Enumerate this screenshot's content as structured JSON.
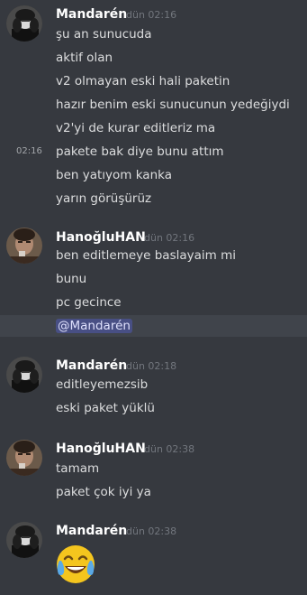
{
  "colors": {
    "background": "#36393f",
    "username": "#ffffff",
    "message_text": "#dcddde",
    "timestamp": "#72767d",
    "mention_highlight": "#40444b",
    "mention_pill": "#5865f2"
  },
  "groups": [
    {
      "avatar_icon": "avatar-mandaren-icon",
      "username": "Mandarén",
      "timestamp": "dün 02:16",
      "hover_timestamp": "02:16",
      "messages": [
        "şu an sunucuda",
        "aktif olan",
        "v2 olmayan eski hali paketin",
        "hazır benim eski sunucunun yedeğiydi",
        "v2'yi de kurar editleriz ma",
        "pakete bak diye bunu attım",
        "ben yatıyom kanka",
        "yarın görüşürüz"
      ]
    },
    {
      "avatar_icon": "avatar-hanogluhan-icon",
      "username": "HanoğluHAN",
      "timestamp": "dün 02:16",
      "messages": [
        "ben editlemeye baslayaim mi",
        "bunu",
        "pc gecince"
      ],
      "mention": "@Mandarén"
    },
    {
      "avatar_icon": "avatar-mandaren-icon",
      "username": "Mandarén",
      "timestamp": "dün 02:18",
      "messages": [
        "editleyemezsib",
        "eski paket yüklü"
      ]
    },
    {
      "avatar_icon": "avatar-hanogluhan-icon",
      "username": "HanoğluHAN",
      "timestamp": "dün 02:38",
      "messages": [
        "tamam",
        "paket çok iyi ya"
      ]
    },
    {
      "avatar_icon": "avatar-mandaren-icon",
      "username": "Mandarén",
      "timestamp": "dün 02:38",
      "emoji_icon": "face-with-tears-of-joy-icon"
    }
  ]
}
